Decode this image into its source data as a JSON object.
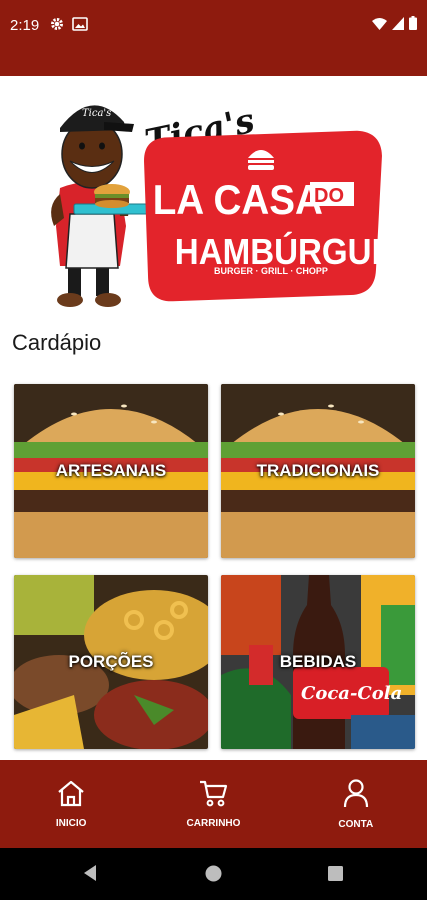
{
  "status_bar": {
    "time": "2:19",
    "left_icons": [
      "gear-icon",
      "image-icon"
    ],
    "right_icons": [
      "wifi-icon",
      "signal-icon",
      "battery-icon"
    ]
  },
  "logo": {
    "script_text": "Tica's",
    "line1": "LA CASA",
    "do": "DO",
    "line2": "HAMBÚRGUER",
    "tagline": "BURGER · GRILL · CHOPP",
    "cap_text": "Tica's",
    "brand_color": "#e3242b"
  },
  "section_title": "Cardápio",
  "menu": [
    {
      "label": "ARTESANAIS",
      "image": "burger"
    },
    {
      "label": "TRADICIONAIS",
      "image": "burger"
    },
    {
      "label": "PORÇÕES",
      "image": "fries"
    },
    {
      "label": "BEBIDAS",
      "image": "drinks"
    }
  ],
  "bottom_nav": [
    {
      "label": "INICIO",
      "icon": "home-icon"
    },
    {
      "label": "CARRINHO",
      "icon": "cart-icon"
    },
    {
      "label": "CONTA",
      "icon": "user-icon"
    }
  ],
  "colors": {
    "bar": "#8e1b0e",
    "accent": "#e3242b",
    "nav_bg": "#000000"
  }
}
